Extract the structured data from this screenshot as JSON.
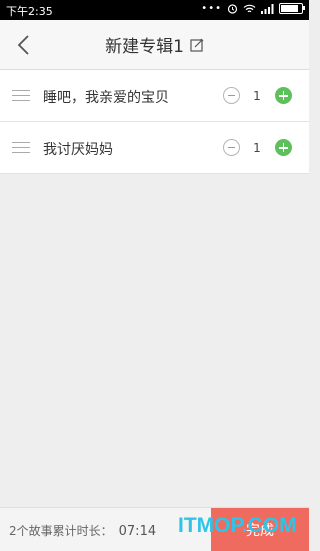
{
  "status_bar": {
    "time": "下午2:35",
    "battery_level": 0.85
  },
  "header": {
    "title": "新建专辑1"
  },
  "stories": [
    {
      "title": "睡吧，我亲爱的宝贝",
      "count": "1"
    },
    {
      "title": "我讨厌妈妈",
      "count": "1"
    }
  ],
  "footer": {
    "duration_label": "2个故事累计时长：",
    "duration_value": "07:14",
    "done_label": "完成",
    "watermark": "ITMOP.COM"
  },
  "colors": {
    "accent_green": "#5cc15a",
    "done_red": "#ef6b60",
    "watermark": "#2ec4e8"
  }
}
